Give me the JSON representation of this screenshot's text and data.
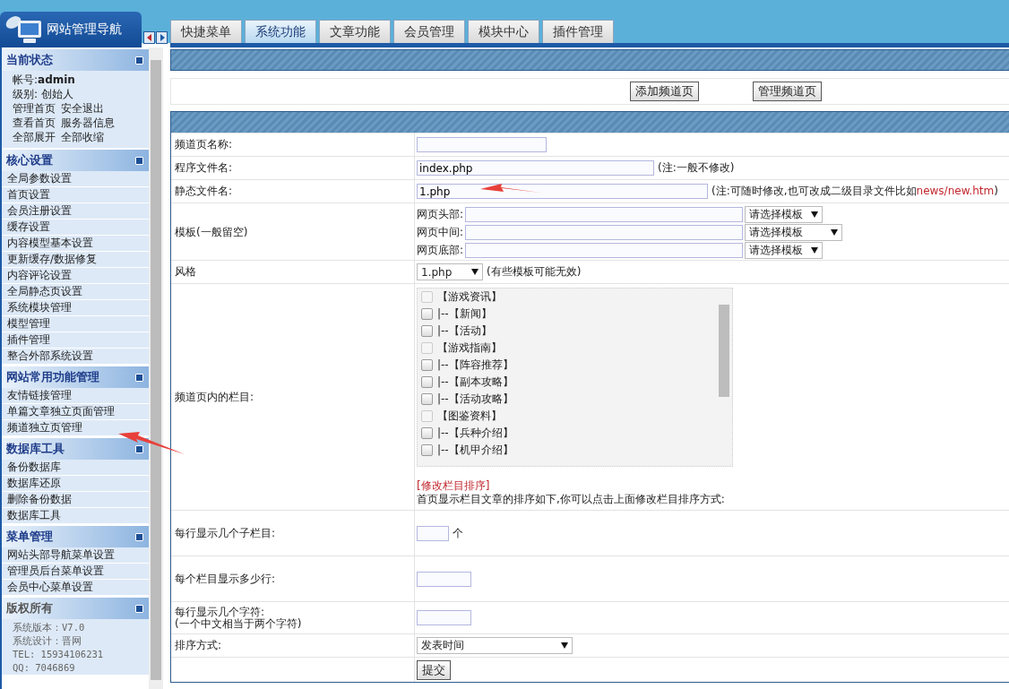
{
  "sidebar": {
    "title": "网站管理导航",
    "sections": [
      {
        "title": "当前状态",
        "kind": "status",
        "lines": [
          [
            "帐号:**admin**"
          ],
          [
            "级别: 创始人"
          ],
          [
            "管理首页",
            "安全退出"
          ],
          [
            "查看首页",
            "服务器信息"
          ],
          [
            "全部展开",
            "全部收缩"
          ]
        ]
      },
      {
        "title": "核心设置",
        "kind": "menu",
        "items": [
          "全局参数设置",
          "首页设置",
          "会员注册设置",
          "缓存设置",
          "内容模型基本设置",
          "更新缓存/数据修复",
          "内容评论设置",
          "全局静态页设置",
          "系统模块管理",
          "模型管理",
          "插件管理",
          "整合外部系统设置"
        ]
      },
      {
        "title": "网站常用功能管理",
        "kind": "menu",
        "items": [
          "友情链接管理",
          "单篇文章独立页面管理",
          "频道独立页管理"
        ]
      },
      {
        "title": "数据库工具",
        "kind": "menu",
        "items": [
          "备份数据库",
          "数据库还原",
          "删除备份数据",
          "数据库工具"
        ]
      },
      {
        "title": "菜单管理",
        "kind": "menu",
        "items": [
          "网站头部导航菜单设置",
          "管理员后台菜单设置",
          "会员中心菜单设置"
        ]
      },
      {
        "title": "版权所有",
        "kind": "info",
        "lines": [
          [
            "系统版本：V7.0"
          ],
          [
            "系统设计：晋网"
          ],
          [
            "TEL: 15934106231"
          ],
          [
            "QQ: 7046869"
          ]
        ]
      }
    ]
  },
  "tabs": [
    {
      "label": "快捷菜单",
      "selected": false
    },
    {
      "label": "系统功能",
      "selected": true
    },
    {
      "label": "文章功能",
      "selected": false
    },
    {
      "label": "会员管理",
      "selected": false
    },
    {
      "label": "模块中心",
      "selected": false
    },
    {
      "label": "插件管理",
      "selected": false
    }
  ],
  "toolbar": {
    "buttons": [
      "添加频道页",
      "管理频道页"
    ]
  },
  "form": {
    "rows": [
      {
        "kind": "text",
        "label": "频道页名称:"
      },
      {
        "kind": "text",
        "label": "程序文件名:",
        "value": "index.php",
        "note": "(注:一般不修改)"
      },
      {
        "kind": "text",
        "label": "静态文件名:",
        "value": "1.php",
        "note": "(注:可随时修改,也可改成二级目录文件比如",
        "note_link": "news/new.htm",
        "note_end": ")"
      },
      {
        "kind": "templates",
        "label": "模板(一般留空)",
        "fields": [
          {
            "label": "网页头部:",
            "select": "请选择模板"
          },
          {
            "label": "网页中间:",
            "select": "请选择模板"
          },
          {
            "label": "网页底部:",
            "select": "请选择模板"
          }
        ]
      },
      {
        "kind": "select",
        "label": "风格",
        "value": "1.php",
        "note": "(有些模板可能无效)"
      },
      {
        "kind": "checklist",
        "label": "频道页内的栏目:",
        "items": [
          {
            "label": "【游戏资讯】",
            "disabled": true,
            "children": [
              {
                "label": "|--【新闻】",
                "disabled": false
              },
              {
                "label": "|--【活动】",
                "disabled": false
              }
            ]
          },
          {
            "label": "【游戏指南】",
            "disabled": true,
            "children": [
              {
                "label": "|--【阵容推荐】",
                "disabled": false
              },
              {
                "label": "|--【副本攻略】",
                "disabled": false
              },
              {
                "label": "|--【活动攻略】",
                "disabled": false
              }
            ]
          },
          {
            "label": "【图鉴资料】",
            "disabled": true,
            "children": [
              {
                "label": "|--【兵种介绍】",
                "disabled": false
              },
              {
                "label": "|--【机甲介绍】",
                "disabled": false
              }
            ]
          }
        ],
        "link": "[修改栏目排序]",
        "hint": "首页显示栏目文章的排序如下,你可以点击上面修改栏目排序方式:"
      },
      {
        "kind": "small",
        "label": "每行显示几个子栏目:",
        "suffix": "个"
      },
      {
        "kind": "small",
        "label": "每个栏目显示多少行:"
      },
      {
        "kind": "small",
        "label": "每行显示几个字符:\n(一个中文相当于两个字符)"
      },
      {
        "kind": "select",
        "label": "排序方式:",
        "value": "发表时间"
      },
      {
        "kind": "submit",
        "button": "提交"
      }
    ]
  }
}
